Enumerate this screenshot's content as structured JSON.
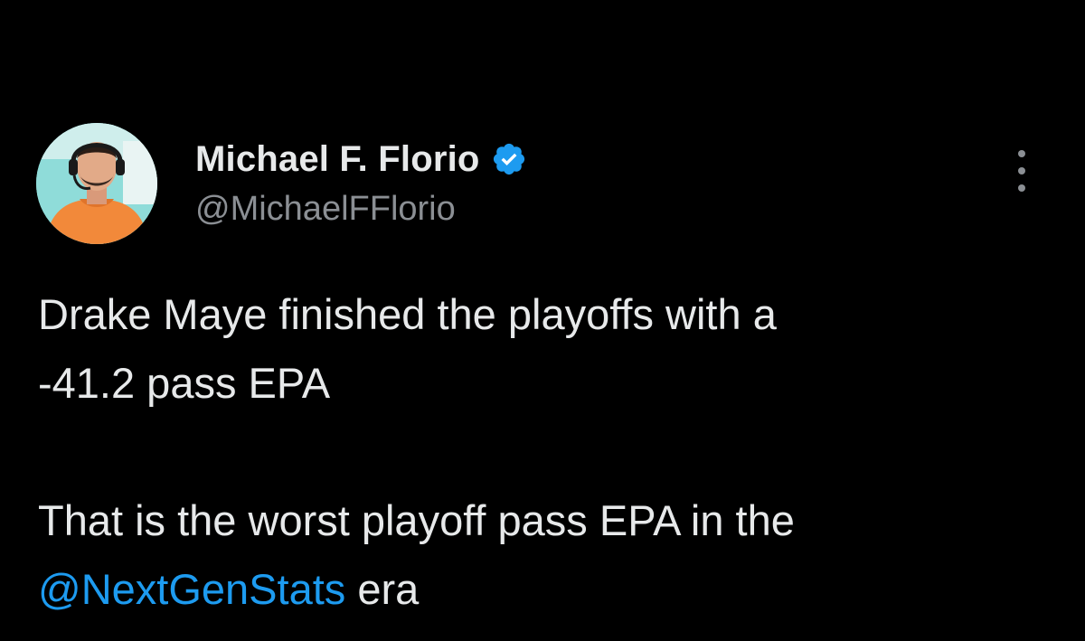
{
  "author": {
    "display_name": "Michael F. Florio",
    "handle": "@MichaelFFlorio",
    "verified": true,
    "avatar_icon": "person-headset-avatar"
  },
  "more_icon": "more-options-icon",
  "tweet": {
    "line1": "Drake Maye finished the playoffs with a",
    "line2": "-41.2 pass EPA",
    "line3": "That is the worst playoff pass EPA in the",
    "mention": "@NextGenStats",
    "line4_suffix": " era"
  },
  "colors": {
    "background": "#000000",
    "text": "#e7e9ea",
    "secondary": "#8b8f94",
    "link": "#1d9bf0",
    "verified_badge": "#1d9bf0"
  }
}
